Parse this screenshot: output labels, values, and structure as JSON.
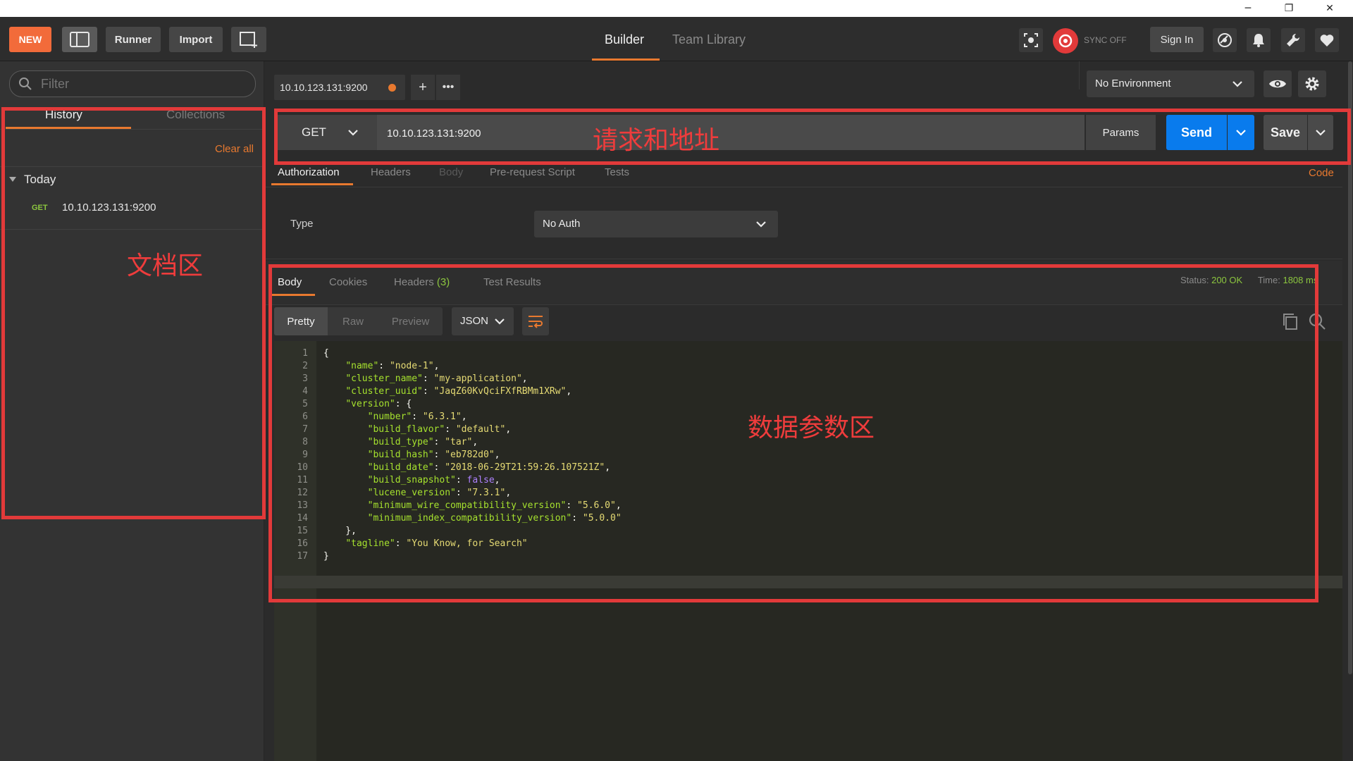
{
  "window": {
    "minimize": "─",
    "restore": "❐",
    "close": "✕"
  },
  "header": {
    "new_label": "NEW",
    "runner_label": "Runner",
    "import_label": "Import",
    "nav_builder": "Builder",
    "nav_team_library": "Team Library",
    "sync_label": "SYNC OFF",
    "sign_in_label": "Sign In"
  },
  "sidebar": {
    "filter_placeholder": "Filter",
    "tab_history": "History",
    "tab_collections": "Collections",
    "clear_all": "Clear all",
    "group_today": "Today",
    "history_items": [
      {
        "method": "GET",
        "url": "10.10.123.131:9200"
      }
    ]
  },
  "request": {
    "tab_title": "10.10.123.131:9200",
    "method": "GET",
    "url": "10.10.123.131:9200",
    "params_label": "Params",
    "send_label": "Send",
    "save_label": "Save",
    "environment": "No Environment",
    "subtabs": [
      "Authorization",
      "Headers",
      "Body",
      "Pre-request Script",
      "Tests"
    ],
    "code_link": "Code",
    "auth_type_label": "Type",
    "auth_type_value": "No Auth"
  },
  "response": {
    "tabs": [
      "Body",
      "Cookies",
      "Headers",
      "Test Results"
    ],
    "headers_count": "(3)",
    "status_label": "Status:",
    "status_value": "200 OK",
    "time_label": "Time:",
    "time_value": "1808 ms",
    "view_modes": [
      "Pretty",
      "Raw",
      "Preview"
    ],
    "format": "JSON",
    "body_lines": [
      "{",
      "    \"name\": \"node-1\",",
      "    \"cluster_name\": \"my-application\",",
      "    \"cluster_uuid\": \"JaqZ60KvQciFXfRBMm1XRw\",",
      "    \"version\": {",
      "        \"number\": \"6.3.1\",",
      "        \"build_flavor\": \"default\",",
      "        \"build_type\": \"tar\",",
      "        \"build_hash\": \"eb782d0\",",
      "        \"build_date\": \"2018-06-29T21:59:26.107521Z\",",
      "        \"build_snapshot\": false,",
      "        \"lucene_version\": \"7.3.1\",",
      "        \"minimum_wire_compatibility_version\": \"5.6.0\",",
      "        \"minimum_index_compatibility_version\": \"5.0.0\"",
      "    },",
      "    \"tagline\": \"You Know, for Search\"",
      "}"
    ]
  },
  "annotations": {
    "doc_area": "文档区",
    "request_area": "请求和地址",
    "data_area": "数据参数区"
  },
  "colors": {
    "accent_orange": "#e8792f",
    "send_blue": "#097bed",
    "status_green": "#8cc63f",
    "annotation_red": "#e23a3a"
  }
}
